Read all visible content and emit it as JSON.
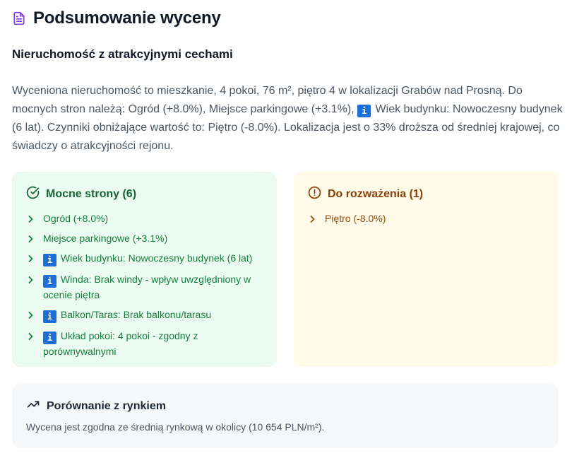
{
  "header": {
    "title": "Podsumowanie wyceny",
    "icon": "document-icon"
  },
  "subtitle": "Nieruchomość z atrakcyjnymi cechami",
  "description": {
    "part1": "Wyceniona nieruchomość to mieszkanie, 4 pokoi, 76 m², piętro 4 w lokalizacji Grabów nad Prosną. Do mocnych stron należą: Ogród (+8.0%), Miejsce parkingowe (+3.1%), ",
    "badge": "i",
    "part2": " Wiek budynku: Nowoczesny budynek (6 lat). Czynniki obniżające wartość to: Piętro (-8.0%). Lokalizacja jest o 33% droższa od średniej krajowej, co świadczy o atrakcyjności rejonu."
  },
  "strengths": {
    "title": "Mocne strony (6)",
    "icon": "check-circle-icon",
    "items": [
      {
        "badge": "",
        "text": "Ogród (+8.0%)"
      },
      {
        "badge": "",
        "text": "Miejsce parkingowe (+3.1%)"
      },
      {
        "badge": "i",
        "text": "Wiek budynku: Nowoczesny budynek (6 lat)"
      },
      {
        "badge": "i",
        "text": "Winda: Brak windy - wpływ uwzględniony w ocenie piętra"
      },
      {
        "badge": "i",
        "text": "Balkon/Taras: Brak balkonu/tarasu"
      },
      {
        "badge": "i",
        "text": "Układ pokoi: 4 pokoi - zgodny z porównywalnymi"
      }
    ]
  },
  "considerations": {
    "title": "Do rozważenia (1)",
    "icon": "alert-circle-icon",
    "items": [
      {
        "badge": "",
        "text": "Piętro (-8.0%)"
      }
    ]
  },
  "market": {
    "title": "Porównanie z rynkiem",
    "icon": "trending-up-icon",
    "text": "Wycena jest zgodna ze średnią rynkową w okolicy (10 654 PLN/m²)."
  },
  "colors": {
    "strengths_bg": "#ecfbf1",
    "strengths_text": "#15803d",
    "consider_bg": "#fefbe8",
    "consider_text": "#9a4a0c",
    "info_badge": "#1d6fd6",
    "doc_icon": "#7c3aed"
  }
}
